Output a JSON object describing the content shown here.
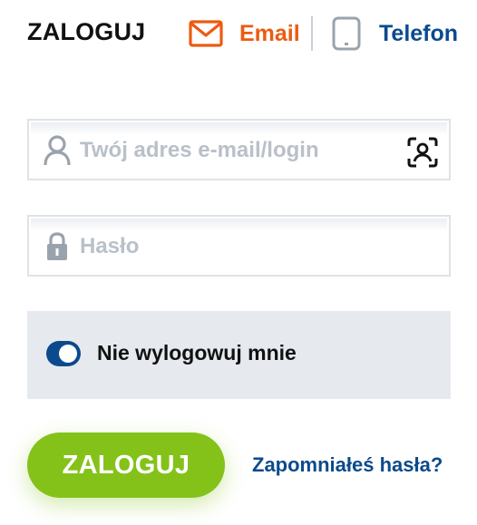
{
  "header": {
    "title": "ZALOGUJ",
    "tabs": [
      {
        "label": "Email",
        "icon": "mail-icon",
        "active": true,
        "color": "#ec5b11"
      },
      {
        "label": "Telefon",
        "icon": "phone-icon",
        "active": false,
        "color": "#0b4a8c"
      }
    ]
  },
  "form": {
    "email_placeholder": "Twój adres e-mail/login",
    "email_value": "",
    "password_placeholder": "Hasło",
    "password_value": "",
    "remember_label": "Nie wylogowuj mnie",
    "remember_checked": true,
    "submit_label": "ZALOGUJ",
    "forgot_label": "Zapomniałeś hasła?"
  },
  "icons": {
    "email_field": "user-icon",
    "face_id": "face-id-icon",
    "password_field": "lock-icon"
  },
  "colors": {
    "accent_orange": "#ec5b11",
    "brand_blue": "#0b4a8c",
    "submit_green": "#84c21a",
    "panel_gray": "#e6e9ee"
  }
}
